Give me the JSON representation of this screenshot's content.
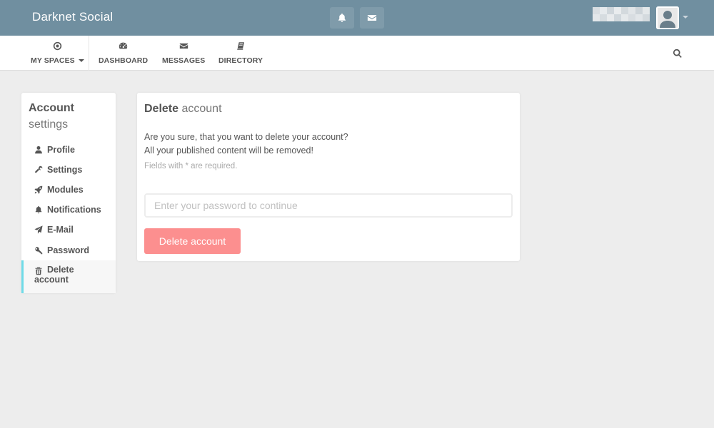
{
  "app": {
    "brand": "Darknet Social"
  },
  "topbar": {
    "notifications_icon": "bell-icon",
    "messages_icon": "envelope-icon",
    "user_name_pixel_colors": [
      "#d9dee2",
      "#e6eaed",
      "#cfd6db",
      "#e9ecee",
      "#d3d9dd",
      "#e1e5e8",
      "#cdd4d9",
      "#e4e8ea",
      "#e3e7ea",
      "#d6dce0",
      "#e8ebed",
      "#d0d7dc",
      "#e5e9eb",
      "#d8dde1",
      "#e2e6e9",
      "#d4dade"
    ],
    "accent_color": "#708fa0"
  },
  "nav": {
    "items": [
      {
        "label": "MY SPACES",
        "icon": "dot-circle-icon",
        "has_dropdown": true
      },
      {
        "label": "DASHBOARD",
        "icon": "tachometer-icon"
      },
      {
        "label": "MESSAGES",
        "icon": "envelope-icon"
      },
      {
        "label": "DIRECTORY",
        "icon": "book-icon"
      }
    ],
    "search_icon": "search-icon"
  },
  "sidebar": {
    "title": "Account",
    "subtitle": "settings",
    "items": [
      {
        "label": "Profile",
        "icon": "user-icon"
      },
      {
        "label": "Settings",
        "icon": "wrench-icon"
      },
      {
        "label": "Modules",
        "icon": "rocket-icon"
      },
      {
        "label": "Notifications",
        "icon": "bell-icon"
      },
      {
        "label": "E-Mail",
        "icon": "paper-plane-icon"
      },
      {
        "label": "Password",
        "icon": "key-icon"
      },
      {
        "label_line1": "Delete",
        "label_line2": "account",
        "icon": "trash-icon",
        "active": true
      }
    ],
    "active_color": "#6fdbe8"
  },
  "main": {
    "title_bold": "Delete",
    "title_light": "account",
    "line1": "Are you sure, that you want to delete your account?",
    "line2": "All your published content will be removed!",
    "hint": "Fields with * are required.",
    "password_placeholder": "Enter your password to continue",
    "password_value": "",
    "delete_button_label": "Delete account",
    "delete_button_color": "#fc8f8f"
  }
}
